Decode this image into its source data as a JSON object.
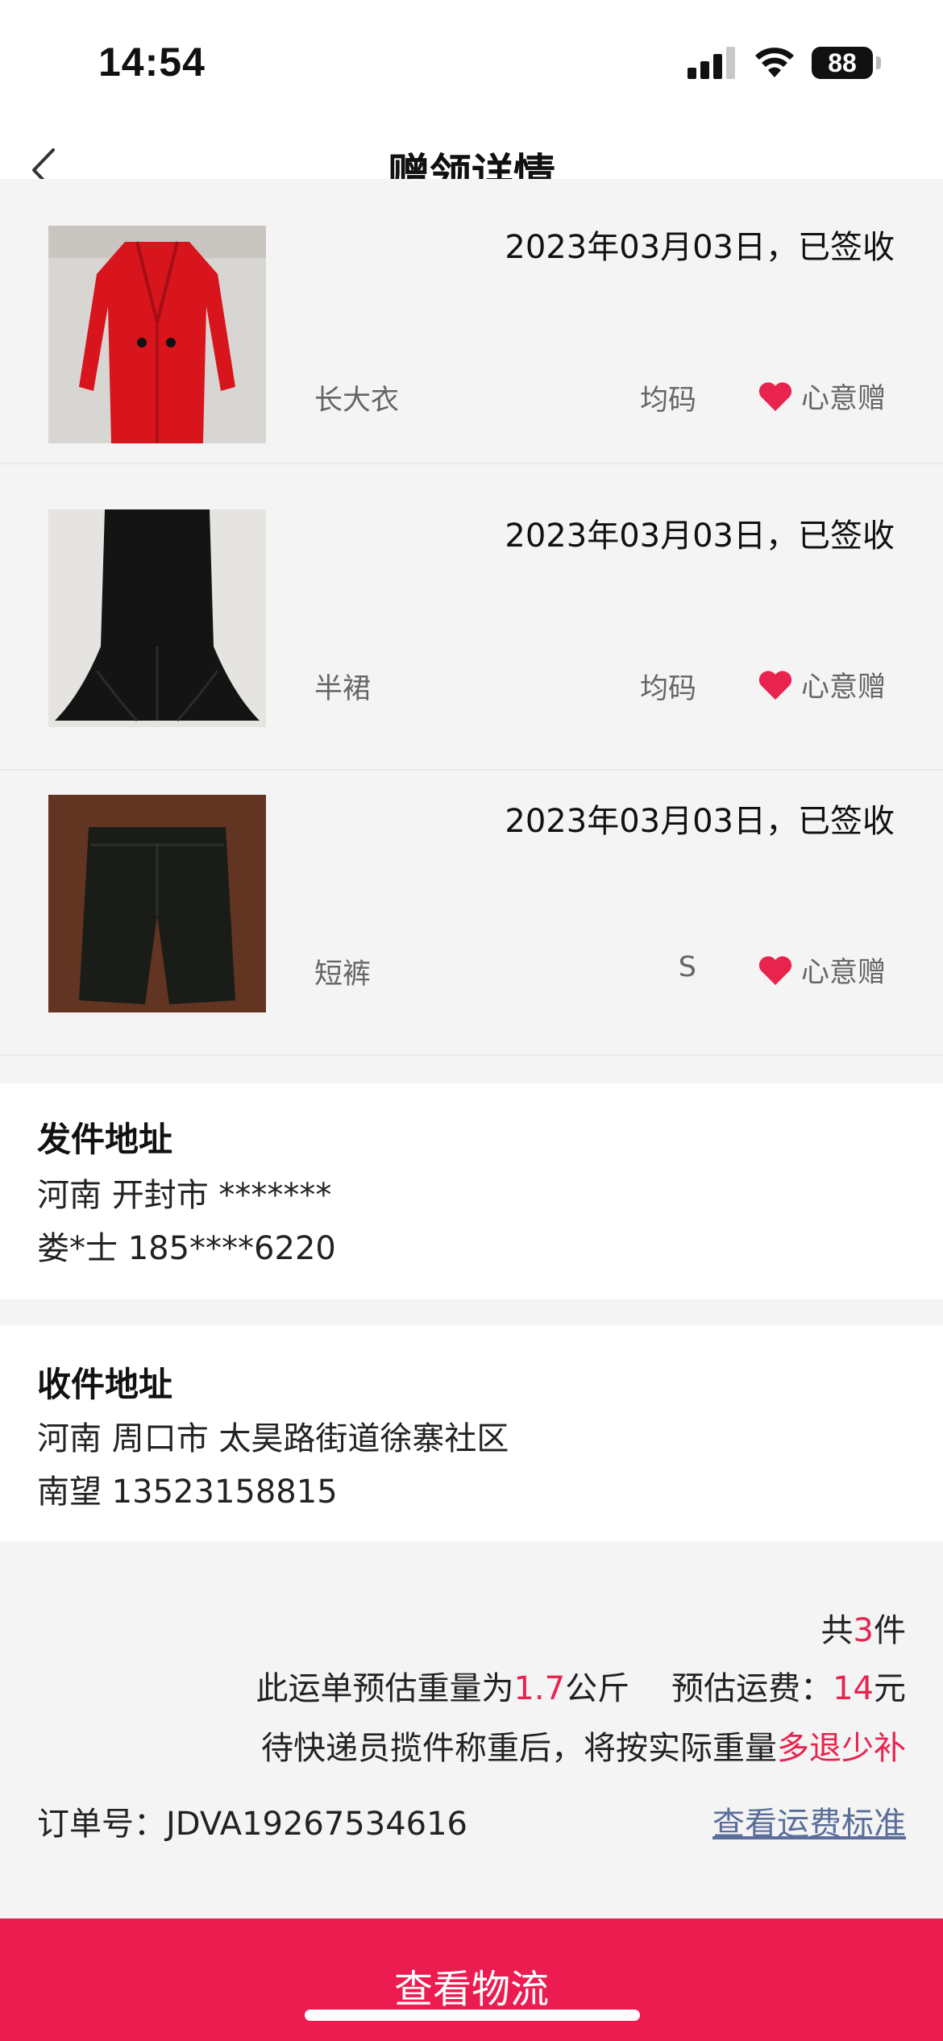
{
  "status_bar": {
    "time": "14:54",
    "battery": "88",
    "icons": [
      "signal-icon",
      "wifi-icon",
      "battery-icon"
    ]
  },
  "nav": {
    "title": "赠领详情",
    "back_icon": "chevron-left-icon"
  },
  "items": [
    {
      "date_status": "2023年03月03日，已签收",
      "name": "长大衣",
      "size": "均码",
      "tag": "心意赠",
      "image": "red-coat"
    },
    {
      "date_status": "2023年03月03日，已签收",
      "name": "半裙",
      "size": "均码",
      "tag": "心意赠",
      "image": "black-skirt"
    },
    {
      "date_status": "2023年03月03日，已签收",
      "name": "短裤",
      "size": "S",
      "tag": "心意赠",
      "image": "black-shorts"
    }
  ],
  "sender": {
    "title": "发件地址",
    "address": "河南 开封市 *******",
    "contact": "娄*士 185****6220"
  },
  "receiver": {
    "title": "收件地址",
    "address": "河南 周口市 太昊路街道徐寨社区",
    "contact": "南望 13523158815"
  },
  "summary": {
    "count_prefix": "共",
    "count": "3",
    "count_suffix": "件",
    "weight_prefix": "此运单预估重量为",
    "weight": "1.7",
    "weight_unit": "公斤",
    "fee_label": "预估运费：",
    "fee": "14",
    "fee_unit": "元",
    "note_prefix": "待快递员揽件称重后，将按实际重量",
    "note_highlight": "多退少补",
    "order_label": "订单号：",
    "order_no": "JDVA19267534616",
    "fee_standard_link": "查看运费标准"
  },
  "bottom_button": {
    "label": "查看物流"
  },
  "colors": {
    "accent": "#ec1c50",
    "highlight_text": "#e8234e",
    "link": "#5b6e9b"
  }
}
